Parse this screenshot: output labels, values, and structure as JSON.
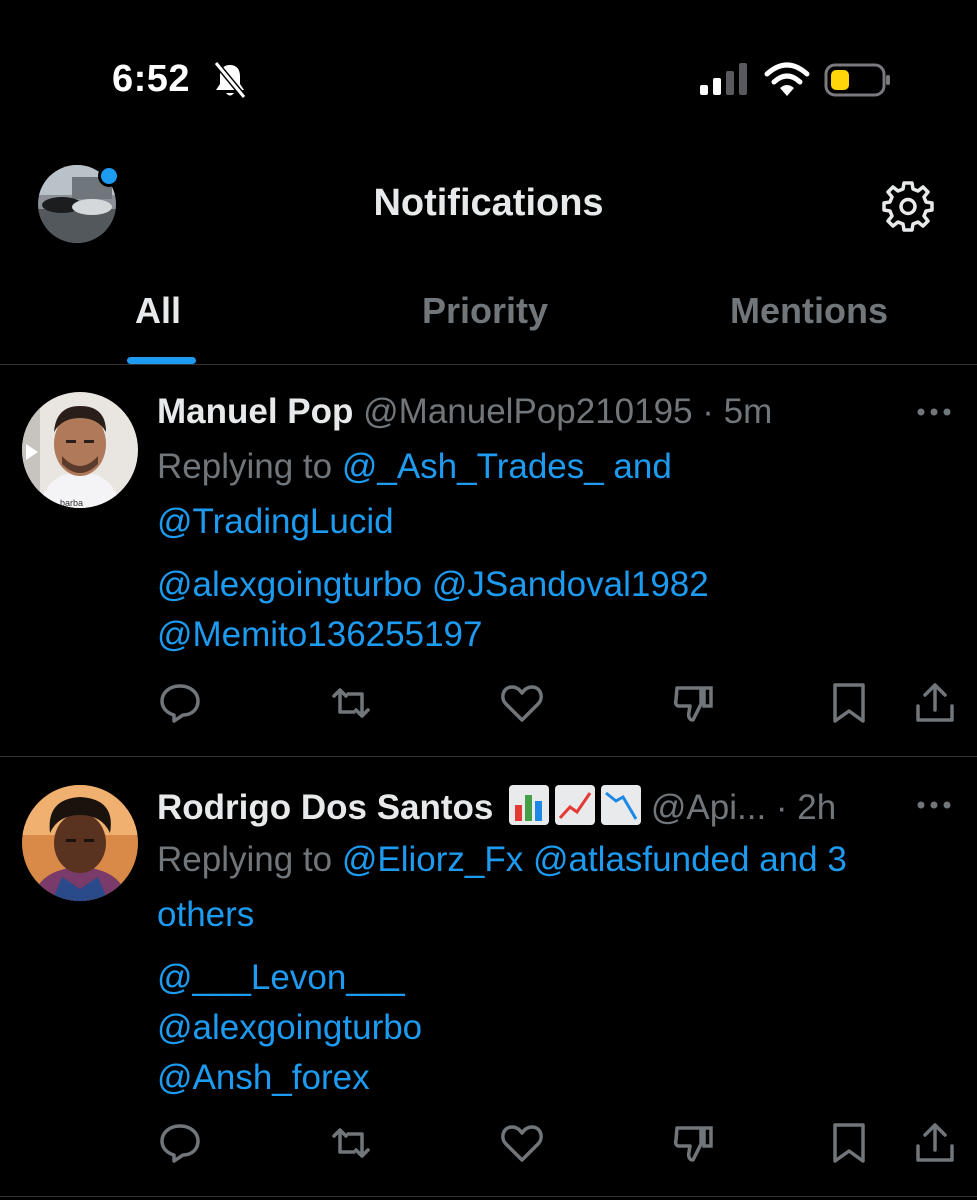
{
  "status_bar": {
    "time": "6:52"
  },
  "header": {
    "title": "Notifications"
  },
  "tabs": [
    {
      "label": "All",
      "active": true
    },
    {
      "label": "Priority",
      "active": false
    },
    {
      "label": "Mentions",
      "active": false
    }
  ],
  "colors": {
    "accent": "#1d9bf0",
    "muted": "#71767b",
    "text": "#e7e9ea",
    "background": "#000000",
    "divider": "#2f3336"
  },
  "posts": [
    {
      "name": "Manuel Pop",
      "handle": "@ManuelPop210195",
      "time": "5m",
      "replying_prefix": "Replying to",
      "replying_line1": "@_Ash_Trades_ and",
      "replying_line2": "@TradingLucid",
      "mentions_line1": "@alexgoingturbo @JSandoval1982",
      "mentions_line2": "@Memito136255197",
      "avatar_caption": "barba"
    },
    {
      "name": "Rodrigo Dos Santos",
      "emojis": [
        "bar-chart-emoji",
        "chart-increasing-emoji",
        "chart-decreasing-emoji"
      ],
      "handle": "@Api...",
      "time": "2h",
      "replying_prefix": "Replying to",
      "replying_line1": "@Eliorz_Fx @atlasfunded and 3",
      "replying_line2": "others",
      "mentions_line1": "@___Levon___",
      "mentions_line2": "@alexgoingturbo",
      "mentions_line3": "@Ansh_forex"
    }
  ],
  "actions": [
    "reply-icon",
    "retweet-icon",
    "like-icon",
    "dislike-icon",
    "bookmark-icon",
    "share-icon"
  ]
}
